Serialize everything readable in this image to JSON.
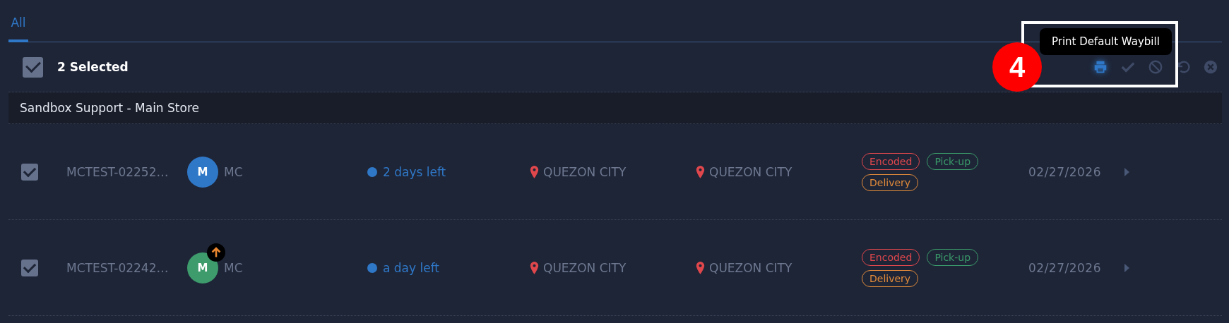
{
  "tabs": [
    {
      "label": "All",
      "selected": true
    }
  ],
  "toolbar": {
    "all_checked": true,
    "selected_count": "2 Selected",
    "actions": [
      {
        "kind": "print",
        "active": true
      },
      {
        "kind": "approve",
        "active": false
      },
      {
        "kind": "block",
        "active": false
      },
      {
        "kind": "undo",
        "active": false
      },
      {
        "kind": "cancel",
        "active": false
      }
    ],
    "tooltip": "Print Default Waybill"
  },
  "annotation": {
    "label": "4"
  },
  "group": {
    "title": "Sandbox Support - Main Store"
  },
  "rows": [
    {
      "checked": true,
      "id": "MCTEST-02252…",
      "avatar": {
        "initial": "M",
        "color": "#2f78c8"
      },
      "badge": false,
      "name": "MC",
      "due": "2 days left",
      "origin": "QUEZON CITY",
      "destination": "QUEZON CITY",
      "tags": [
        {
          "label": "Encoded",
          "color": "#e0474c"
        },
        {
          "label": "Pick-up",
          "color": "#3a9a6a"
        },
        {
          "label": "Delivery",
          "color": "#e08a3a"
        }
      ],
      "date": "02/27/2026"
    },
    {
      "checked": true,
      "id": "MCTEST-02242…",
      "avatar": {
        "initial": "M",
        "color": "#3d9b6c"
      },
      "badge": true,
      "name": "MC",
      "due": "a day left",
      "origin": "QUEZON CITY",
      "destination": "QUEZON CITY",
      "tags": [
        {
          "label": "Encoded",
          "color": "#e0474c"
        },
        {
          "label": "Pick-up",
          "color": "#3a9a6a"
        },
        {
          "label": "Delivery",
          "color": "#e08a3a"
        }
      ],
      "date": "02/27/2026"
    }
  ]
}
